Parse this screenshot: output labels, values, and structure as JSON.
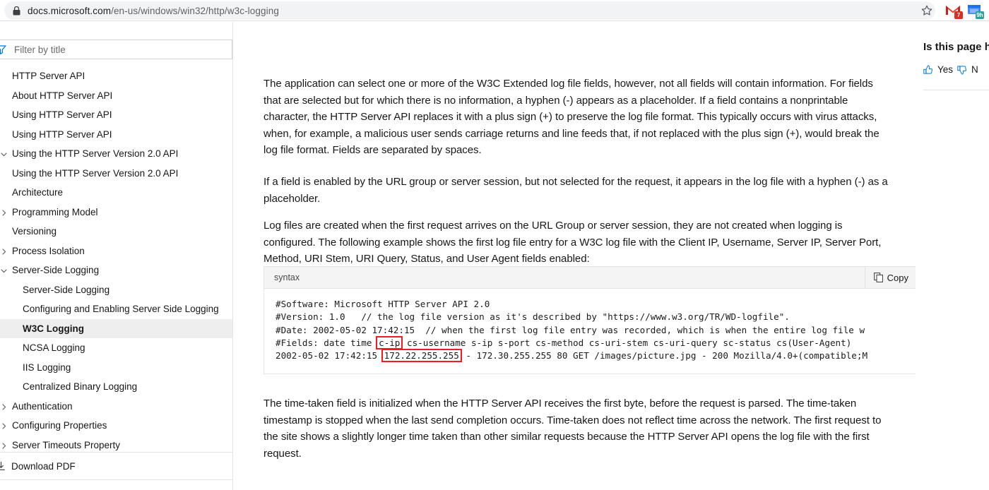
{
  "browser": {
    "lock_icon": "lock-icon",
    "url_domain": "docs.microsoft.com",
    "url_path": "/en-us/windows/win32/http/w3c-logging",
    "star_icon": "bookmark-star-icon",
    "extensions": [
      {
        "name": "gmail-extension-icon",
        "badge": "7"
      },
      {
        "name": "calendar-extension-icon",
        "badge": "9h"
      }
    ]
  },
  "sidebar": {
    "filter": {
      "icon": "filter-icon",
      "placeholder": "Filter by title",
      "value": ""
    },
    "items": [
      {
        "label": "HTTP Server API",
        "indent": 0,
        "chevron": "none",
        "selected": false
      },
      {
        "label": "About HTTP Server API",
        "indent": 0,
        "chevron": "none",
        "selected": false
      },
      {
        "label": "Using HTTP Server API",
        "indent": 0,
        "chevron": "none",
        "selected": false
      },
      {
        "label": "Using HTTP Server API",
        "indent": 1,
        "chevron": "none",
        "selected": false
      },
      {
        "label": "Using the HTTP Server Version 2.0 API",
        "indent": 0,
        "chevron": "expanded",
        "selected": false
      },
      {
        "label": "Using the HTTP Server Version 2.0 API",
        "indent": 1,
        "chevron": "none",
        "selected": false
      },
      {
        "label": "Architecture",
        "indent": 1,
        "chevron": "none",
        "selected": false
      },
      {
        "label": "Programming Model",
        "indent": 1,
        "chevron": "collapsed",
        "selected": false
      },
      {
        "label": "Versioning",
        "indent": 1,
        "chevron": "none",
        "selected": false
      },
      {
        "label": "Process Isolation",
        "indent": 1,
        "chevron": "collapsed",
        "selected": false
      },
      {
        "label": "Server-Side Logging",
        "indent": 1,
        "chevron": "expanded",
        "selected": false
      },
      {
        "label": "Server-Side Logging",
        "indent": 2,
        "chevron": "none",
        "selected": false
      },
      {
        "label": "Configuring and Enabling Server Side Logging",
        "indent": 2,
        "chevron": "none",
        "selected": false
      },
      {
        "label": "W3C Logging",
        "indent": 2,
        "chevron": "none",
        "selected": true
      },
      {
        "label": "NCSA Logging",
        "indent": 2,
        "chevron": "none",
        "selected": false
      },
      {
        "label": "IIS Logging",
        "indent": 2,
        "chevron": "none",
        "selected": false
      },
      {
        "label": "Centralized Binary Logging",
        "indent": 2,
        "chevron": "none",
        "selected": false
      },
      {
        "label": "Authentication",
        "indent": 1,
        "chevron": "collapsed",
        "selected": false
      },
      {
        "label": "Configuring Properties",
        "indent": 1,
        "chevron": "collapsed",
        "selected": false
      },
      {
        "label": "Server Timeouts Property",
        "indent": 1,
        "chevron": "collapsed",
        "selected": false
      }
    ],
    "footer": {
      "icon": "download-icon",
      "label": "Download PDF"
    }
  },
  "main": {
    "paragraph_1": "The application can select one or more of the W3C Extended log file fields, however, not all fields will contain information. For fields that are selected but for which there is no information, a hyphen (-) appears as a placeholder. If a field contains a nonprintable character, the HTTP Server API replaces it with a plus sign (+) to preserve the log file format. This typically occurs with virus attacks, when, for example, a malicious user sends carriage returns and line feeds that, if not replaced with the plus sign (+), would break the log file format. Fields are separated by spaces.",
    "paragraph_2": "If a field is enabled by the URL group or server session, but not selected for the request, it appears in the log file with a hyphen (-) as a placeholder.",
    "paragraph_3": "Log files are created when the first request arrives on the URL Group or server session, they are not created when logging is configured. The following example shows the first log file entry for a W3C log file with the Client IP, Username, Server IP, Server Port, Method, URI Stem, URI Query, Status, and User Agent fields enabled:",
    "paragraph_4": "The time-taken field is initialized when the HTTP Server API receives the first byte, before the request is parsed. The time-taken timestamp is stopped when the last send completion occurs. Time-taken does not reflect time across the network. The first request to the site shows a slightly longer time taken than other similar requests because the HTTP Server API opens the log file with the first request.",
    "codeblock": {
      "language": "syntax",
      "copy_label": "Copy",
      "copy_icon": "copy-icon",
      "highlight_color": "#ee1c25",
      "lines": [
        {
          "text": "#Software: Microsoft HTTP Server API 2.0"
        },
        {
          "text": "#Version: 1.0   // the log file version as it's described by \"https://www.w3.org/TR/WD-logfile\"."
        },
        {
          "text": "#Date: 2002-05-02 17:42:15  // when the first log file entry was recorded, which is when the entire log file w"
        },
        {
          "pre": "#Fields: date time ",
          "highlight": "c-ip",
          "post": " cs-username s-ip s-port cs-method cs-uri-stem cs-uri-query sc-status cs(User-Agent)"
        },
        {
          "pre": "2002-05-02 17:42:15 ",
          "highlight": "172.22.255.255",
          "post": " - 172.30.255.255 80 GET /images/picture.jpg - 200 Mozilla/4.0+(compatible;M"
        }
      ]
    }
  },
  "rightrail": {
    "title": "Is this page h",
    "yes_label": "Yes",
    "no_label": "N",
    "thumbs_up_icon": "thumbs-up-icon",
    "thumbs_down_icon": "thumbs-down-icon"
  }
}
